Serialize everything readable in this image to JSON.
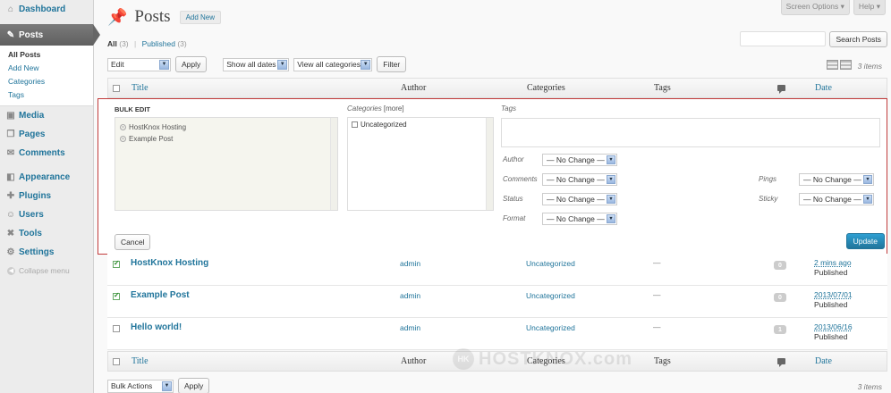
{
  "sidebar": {
    "items": [
      {
        "label": "Dashboard",
        "icon": "dashboard-icon"
      },
      {
        "label": "Posts",
        "icon": "pin-icon"
      },
      {
        "label": "Media",
        "icon": "media-icon"
      },
      {
        "label": "Pages",
        "icon": "pages-icon"
      },
      {
        "label": "Comments",
        "icon": "comments-icon"
      },
      {
        "label": "Appearance",
        "icon": "appearance-icon"
      },
      {
        "label": "Plugins",
        "icon": "plugins-icon"
      },
      {
        "label": "Users",
        "icon": "users-icon"
      },
      {
        "label": "Tools",
        "icon": "tools-icon"
      },
      {
        "label": "Settings",
        "icon": "settings-icon"
      }
    ],
    "submenu": [
      "All Posts",
      "Add New",
      "Categories",
      "Tags"
    ],
    "collapse": "Collapse menu"
  },
  "header": {
    "title": "Posts",
    "add_new": "Add New",
    "screen_options": "Screen Options ▾",
    "help": "Help ▾"
  },
  "filters": {
    "all": "All",
    "all_count": "(3)",
    "separator": "|",
    "published": "Published",
    "published_count": "(3)",
    "search_button": "Search Posts",
    "bulk_select": "Edit",
    "apply": "Apply",
    "dates": "Show all dates",
    "categories": "View all categories",
    "filter": "Filter",
    "items": "3 items"
  },
  "columns": {
    "title": "Title",
    "author": "Author",
    "categories": "Categories",
    "tags": "Tags",
    "date": "Date"
  },
  "bulk_edit": {
    "heading": "BULK EDIT",
    "posts": [
      "HostKnox Hosting",
      "Example Post"
    ],
    "categories_label": "Categories",
    "more": "[more]",
    "category_option": "Uncategorized",
    "tags_label": "Tags",
    "fields": {
      "author": "Author",
      "comments": "Comments",
      "status": "Status",
      "format": "Format",
      "pings": "Pings",
      "sticky": "Sticky"
    },
    "no_change": "— No Change —",
    "cancel": "Cancel",
    "update": "Update"
  },
  "rows": [
    {
      "title": "HostKnox Hosting",
      "author": "admin",
      "category": "Uncategorized",
      "tags": "—",
      "comments": "0",
      "date": "2 mins ago",
      "status": "Published",
      "checked": true
    },
    {
      "title": "Example Post",
      "author": "admin",
      "category": "Uncategorized",
      "tags": "—",
      "comments": "0",
      "date": "2013/07/01",
      "status": "Published",
      "checked": true
    },
    {
      "title": "Hello world!",
      "author": "admin",
      "category": "Uncategorized",
      "tags": "—",
      "comments": "1",
      "date": "2013/06/16",
      "status": "Published",
      "checked": false
    }
  ],
  "bottom": {
    "bulk_actions": "Bulk Actions",
    "apply": "Apply",
    "items": "3 items"
  },
  "watermark": "HOSTKNOX.com",
  "watermark_badge": "HK"
}
